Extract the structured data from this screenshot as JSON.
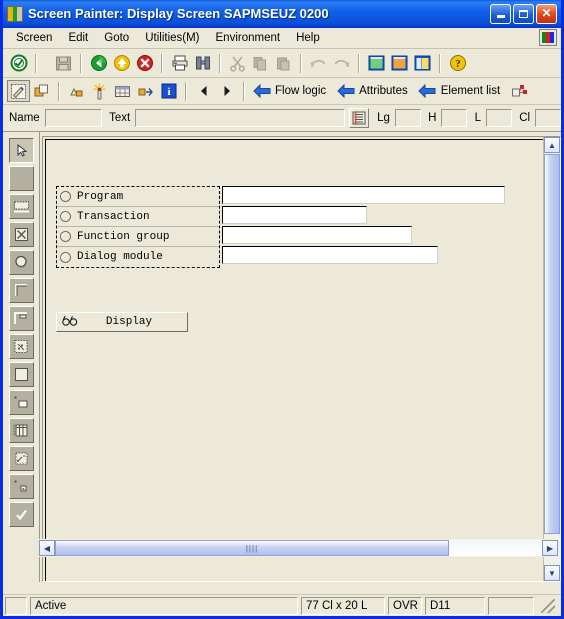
{
  "window": {
    "title": "Screen Painter:  Display Screen SAPMSEUZ 0200",
    "icon": "sap-screen-painter-icon",
    "controls": {
      "minimize": "minimize-button",
      "maximize": "maximize-button",
      "close": "close-button"
    }
  },
  "menu": {
    "items": [
      {
        "label": "Screen"
      },
      {
        "label": "Edit"
      },
      {
        "label": "Goto"
      },
      {
        "label": "Utilities(M)"
      },
      {
        "label": "Environment"
      },
      {
        "label": "Help"
      }
    ],
    "right_icon": "color-bars-icon"
  },
  "toolbar_main": {
    "buttons": [
      {
        "name": "enter-check-icon",
        "enabled": true
      },
      {
        "sep": true
      },
      {
        "name": "save-icon",
        "enabled": false
      },
      {
        "sep": true
      },
      {
        "name": "back-green-arrow-icon",
        "enabled": true
      },
      {
        "name": "exit-yellow-arrow-icon",
        "enabled": true
      },
      {
        "name": "cancel-red-x-icon",
        "enabled": true
      },
      {
        "sep": true
      },
      {
        "name": "print-icon",
        "enabled": true
      },
      {
        "name": "find-binoculars-icon",
        "enabled": true
      },
      {
        "sep": true
      },
      {
        "name": "cut-scissors-icon",
        "enabled": false
      },
      {
        "name": "copy-icon",
        "enabled": false
      },
      {
        "name": "paste-icon",
        "enabled": false
      },
      {
        "sep": true
      },
      {
        "name": "undo-icon",
        "enabled": false
      },
      {
        "name": "redo-icon",
        "enabled": false
      },
      {
        "sep": true
      },
      {
        "name": "window-green-icon",
        "enabled": true
      },
      {
        "name": "window-orange-icon",
        "enabled": true
      },
      {
        "name": "window-yellow-icon",
        "enabled": true
      },
      {
        "sep": true
      },
      {
        "name": "help-question-icon",
        "enabled": true
      }
    ]
  },
  "toolbar_secondary": {
    "buttons": [
      {
        "name": "graphical-layout-editor-icon",
        "pressed": true
      },
      {
        "name": "copy-element-icon"
      },
      {
        "sep": true
      },
      {
        "name": "element-group-icon"
      },
      {
        "name": "wizard-magic-icon"
      },
      {
        "name": "table-control-icon"
      },
      {
        "name": "element-arrange-icon"
      },
      {
        "name": "info-blue-icon"
      },
      {
        "sep": true
      },
      {
        "name": "previous-arrow-icon"
      },
      {
        "name": "next-arrow-icon"
      },
      {
        "sep": true
      }
    ],
    "text_buttons": [
      {
        "label": "Flow logic",
        "icon": "blue-left-arrow-icon"
      },
      {
        "label": "Attributes",
        "icon": "blue-left-arrow-icon"
      },
      {
        "label": "Element list",
        "icon": "blue-left-arrow-icon"
      }
    ],
    "trailing_icon": "element-tree-icon"
  },
  "attribute_bar": {
    "name_label": "Name",
    "name_value": "",
    "text_label": "Text",
    "text_value": "",
    "list_icon": "attribute-list-icon",
    "fields": [
      {
        "label": "Lg",
        "value": ""
      },
      {
        "label": "H",
        "value": ""
      },
      {
        "label": "L",
        "value": ""
      },
      {
        "label": "Cl",
        "value": ""
      }
    ]
  },
  "palette": {
    "tools": [
      {
        "name": "pointer-tool",
        "selected": true
      },
      {
        "name": "blank-tool"
      },
      {
        "name": "text-field-tool"
      },
      {
        "name": "checkbox-tool"
      },
      {
        "name": "radio-button-tool"
      },
      {
        "name": "frame-tool"
      },
      {
        "name": "subscreen-tool"
      },
      {
        "name": "custom-control-tool"
      },
      {
        "name": "box-tool"
      },
      {
        "name": "pushbutton-tool"
      },
      {
        "name": "table-control-tool"
      },
      {
        "name": "tabstrip-tool"
      },
      {
        "name": "status-icon-tool"
      },
      {
        "name": "confirm-tool"
      }
    ]
  },
  "screen": {
    "radio_group": [
      {
        "label": "Program",
        "selected": false,
        "input_width": 283
      },
      {
        "label": "Transaction",
        "selected": false,
        "input_width": 145
      },
      {
        "label": "Function group",
        "selected": false,
        "input_width": 190
      },
      {
        "label": "Dialog module",
        "selected": false,
        "input_width": 216
      }
    ],
    "display_button": {
      "label": "Display",
      "icon": "glasses-icon"
    }
  },
  "scrollbars": {
    "vertical": {
      "up": "scroll-up-arrow",
      "down": "scroll-down-arrow"
    },
    "horizontal": {
      "left": "scroll-left-arrow",
      "right": "scroll-right-arrow",
      "grip": "||||"
    }
  },
  "statusbar": {
    "status": "Active",
    "dimensions": "77 Cl x 20 L",
    "insert_mode": "OVR",
    "system": "D11",
    "extra": ""
  },
  "colors": {
    "title_blue": "#0b5ae8",
    "face": "#ece9d8",
    "border_blue": "#0a2ce0",
    "field_white": "#ffffff"
  }
}
